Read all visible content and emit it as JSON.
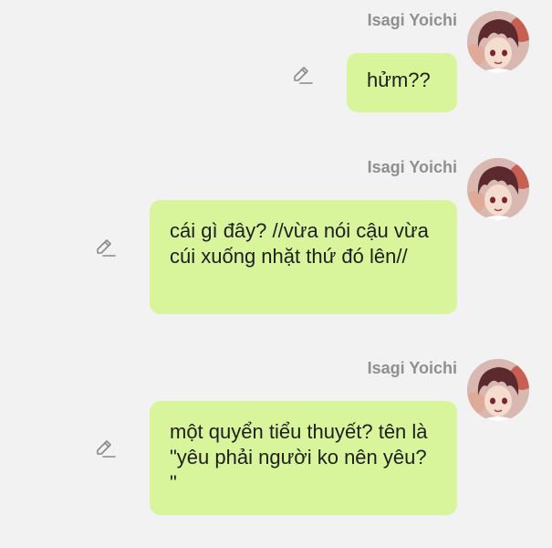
{
  "messages": [
    {
      "sender": "Isagi Yoichi",
      "text": "hửm??",
      "edit_icon": "pencil-icon"
    },
    {
      "sender": "Isagi Yoichi",
      "text": "cái gì đây? //vừa nói cậu vừa cúi xuống nhặt thứ đó lên//",
      "edit_icon": "pencil-icon"
    },
    {
      "sender": "Isagi Yoichi",
      "text": "một quyển tiểu thuyết? tên là \"yêu phải người ko nên yêu? \"",
      "edit_icon": "pencil-icon"
    }
  ],
  "colors": {
    "background": "#f2f2f2",
    "bubble": "#d9f59b",
    "sender_name": "#8f8f8f",
    "text": "#1e1e1e"
  }
}
